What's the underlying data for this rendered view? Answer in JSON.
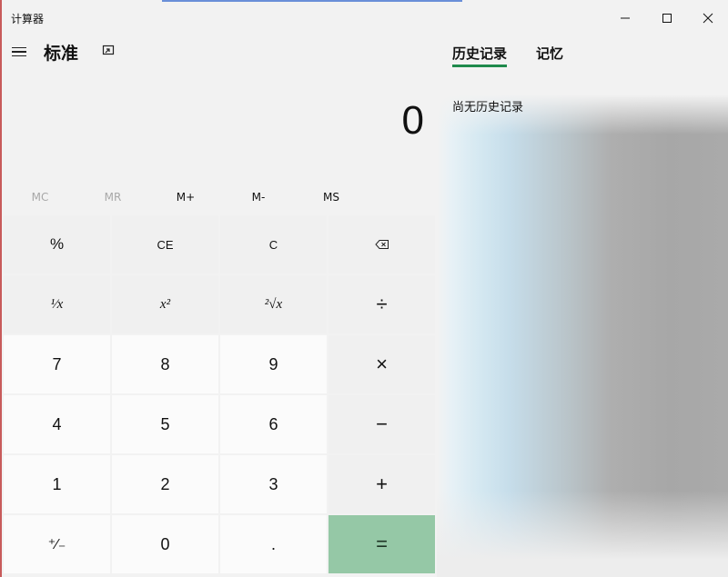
{
  "app": {
    "title": "计算器"
  },
  "window_controls": {
    "minimize": "minimize-icon",
    "maximize": "maximize-icon",
    "close": "close-icon"
  },
  "header": {
    "mode": "标准"
  },
  "display": {
    "value": "0"
  },
  "memory": {
    "buttons": [
      {
        "label": "MC",
        "enabled": false
      },
      {
        "label": "MR",
        "enabled": false
      },
      {
        "label": "M+",
        "enabled": true
      },
      {
        "label": "M-",
        "enabled": true
      },
      {
        "label": "MS",
        "enabled": true
      }
    ]
  },
  "keypad": {
    "percent": "%",
    "ce": "CE",
    "c": "C",
    "backspace": "backspace-icon",
    "reciprocal": "¹⁄x",
    "square": "x²",
    "sqrt": "²√x",
    "divide": "÷",
    "seven": "7",
    "eight": "8",
    "nine": "9",
    "multiply": "×",
    "four": "4",
    "five": "5",
    "six": "6",
    "minus": "−",
    "one": "1",
    "two": "2",
    "three": "3",
    "plus": "+",
    "negate": "⁺⁄₋",
    "zero": "0",
    "decimal": ".",
    "equals": "="
  },
  "panel": {
    "tabs": [
      "历史记录",
      "记忆"
    ],
    "empty_text": "尚无历史记录"
  },
  "colors": {
    "equals_bg": "#95c8a6",
    "tab_underline": "#1f8a4c"
  }
}
